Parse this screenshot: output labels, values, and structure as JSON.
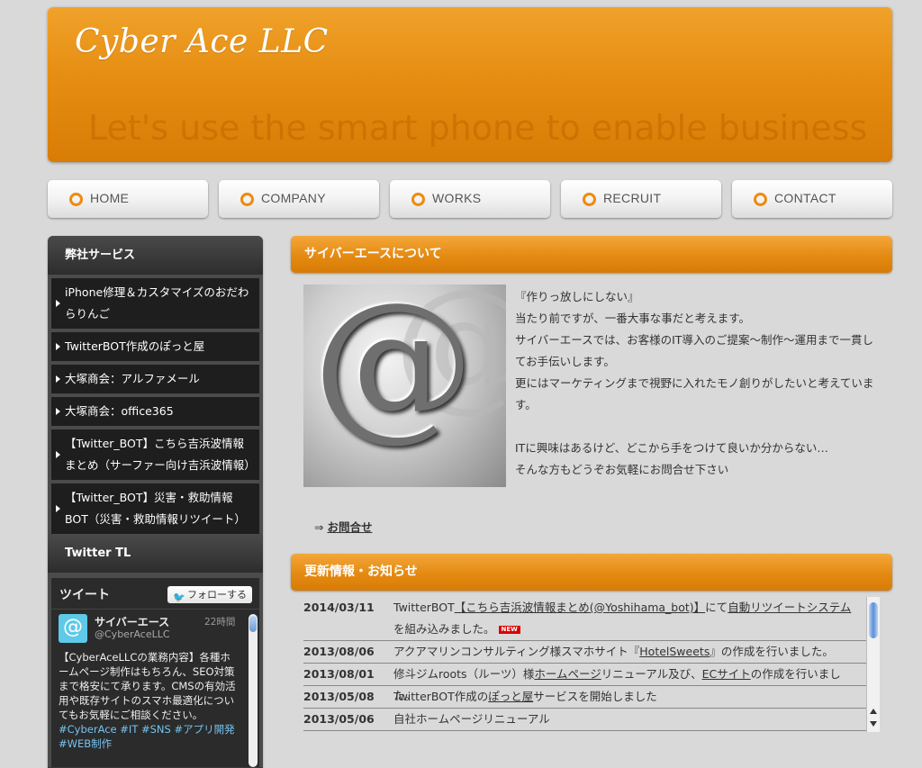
{
  "header": {
    "logo": "Cyber Ace LLC",
    "tagline": "Let's use the smart phone to enable business"
  },
  "nav": {
    "items": [
      {
        "label": "HOME"
      },
      {
        "label": "COMPANY"
      },
      {
        "label": "WORKS"
      },
      {
        "label": "RECRUIT"
      },
      {
        "label": "CONTACT"
      }
    ]
  },
  "sidebar": {
    "services_title": "弊社サービス",
    "services": [
      "iPhone修理＆カスタマイズのおだわらりんご",
      "TwitterBOT作成のぽっと屋",
      "大塚商会：アルファメール",
      "大塚商会：office365",
      "【Twitter_BOT】こちら吉浜波情報まとめ（サーファー向け吉浜波情報）",
      "【Twitter_BOT】災害・救助情報BOT（災害・救助情報リツイート）"
    ],
    "twitter_title": "Twitter TL",
    "twitter": {
      "panel_title": "ツイート",
      "follow_label": "フォローする",
      "follow_icon": "twitter-bird-icon",
      "tweet": {
        "avatar": "@",
        "name": "サイバーエース",
        "handle": "@CyberAceLLC",
        "time": "22時間",
        "text": "【CyberAceLLCの業務内容】各種ホームページ制作はもちろん、SEO対策まで格安にて承ります。CMSの有効活用や既存サイトのスマホ最適化についてもお気軽にご相談ください。",
        "tags": "#CyberAce #IT #SNS #アプリ開発 #WEB制作"
      }
    }
  },
  "about": {
    "title": "サイバーエースについて",
    "image_symbol": "@",
    "lines": [
      "『作りっ放しにしない』",
      "当たり前ですが、一番大事な事だと考えます。",
      "サイバーエースでは、お客様のIT導入のご提案～制作～運用まで一貫してお手伝いします。",
      "更にはマーケティングまで視野に入れたモノ創りがしたいと考えています。",
      "",
      "ITに興味はあるけど、どこから手をつけて良いか分からない…",
      "そんな方もどうぞお気軽にお問合せ下さい"
    ],
    "inquiry_prefix": "⇒",
    "inquiry_link": "お問合せ"
  },
  "news": {
    "title": "更新情報・お知らせ",
    "new_badge": "NEW",
    "items": [
      {
        "date": "2014/03/11",
        "pre": "TwitterBOT",
        "link1": "【こちら吉浜波情報まとめ(@Yoshihama_bot)】",
        "mid": "にて",
        "link2": "自動リツイートシステム",
        "post": "を組み込みました。"
      },
      {
        "date": "2013/08/06",
        "pre": "アクアマリンコンサルティング様スマホサイト『",
        "link1": "HotelSweets",
        "post": "』の作成を行いました。"
      },
      {
        "date": "2013/08/01",
        "pre": "修斗ジムroots（ルーツ）様",
        "link1": "ホームページ",
        "mid": "リニューアル及び、",
        "link2": "ECサイト",
        "post": "の作成を行いました。"
      },
      {
        "date": "2013/05/08",
        "pre": "TwitterBOT作成の",
        "link1": "ぽっと屋",
        "post": "サービスを開始しました"
      },
      {
        "date": "2013/05/06",
        "pre": "自社ホームページリニューアル"
      }
    ]
  }
}
